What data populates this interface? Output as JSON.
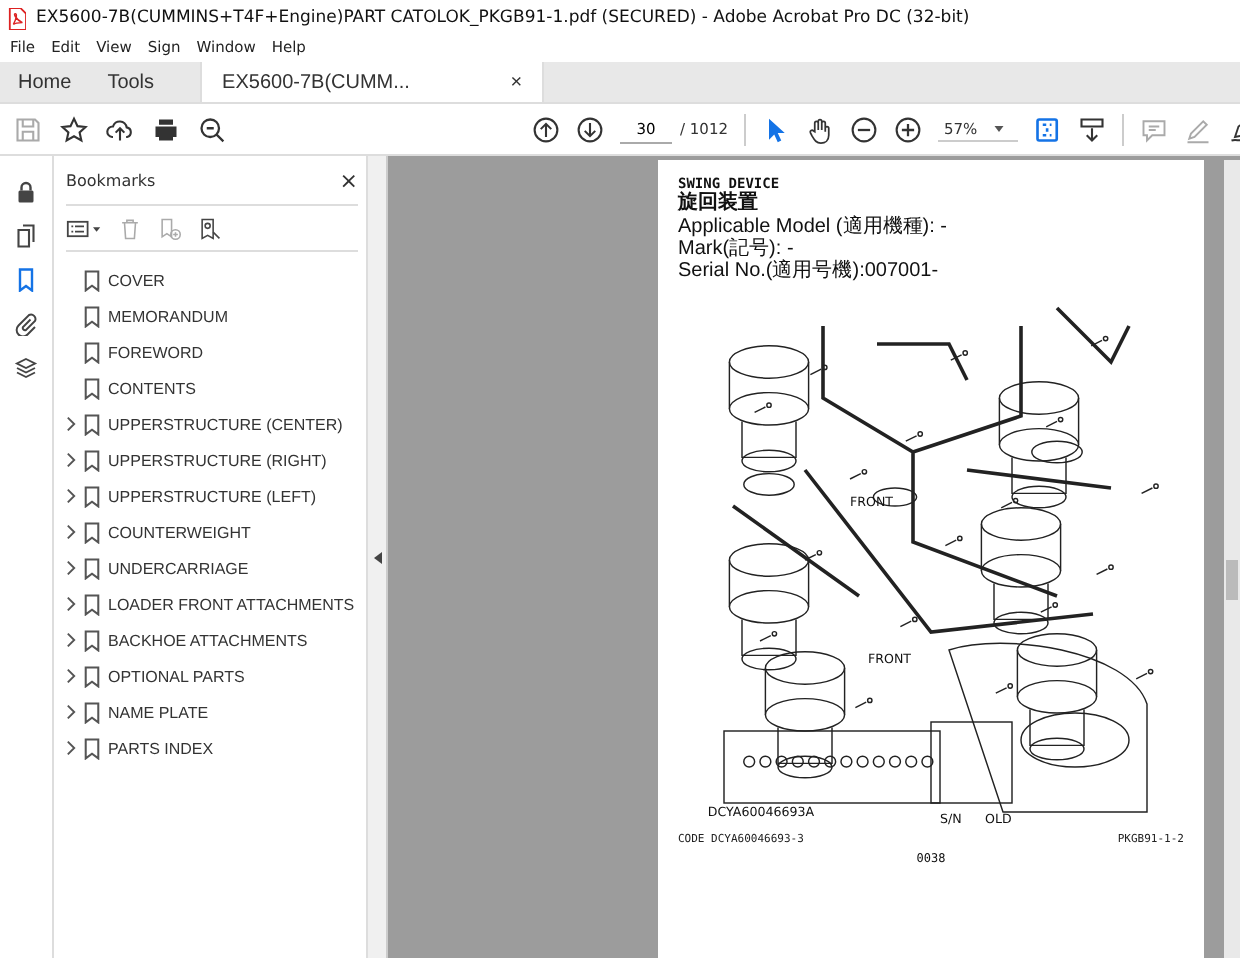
{
  "window": {
    "title": "EX5600-7B(CUMMINS+T4F+Engine)PART CATOLOK_PKGB91-1.pdf (SECURED) - Adobe Acrobat Pro DC (32-bit)"
  },
  "menu": [
    "File",
    "Edit",
    "View",
    "Sign",
    "Window",
    "Help"
  ],
  "tabs": [
    {
      "label": "Home",
      "selected": false
    },
    {
      "label": "Tools",
      "selected": false
    },
    {
      "label": "EX5600-7B(CUMM...",
      "selected": true,
      "close": "×"
    }
  ],
  "toolbar": {
    "page": "30",
    "page_total": "/ 1012",
    "zoom": "57%",
    "save_disabled": true,
    "select_tool_active": true,
    "hand_tool_active": false
  },
  "rail": [
    {
      "kind": "lock",
      "selected": false
    },
    {
      "kind": "pages",
      "selected": false
    },
    {
      "kind": "bookmark",
      "selected": true
    },
    {
      "kind": "clip",
      "selected": false
    },
    {
      "kind": "layers",
      "selected": false
    }
  ],
  "bookmarks": {
    "title": "Bookmarks",
    "close": "×",
    "items": [
      {
        "label": "COVER",
        "kind": "leaf"
      },
      {
        "label": "MEMORANDUM",
        "kind": "leaf"
      },
      {
        "label": "FOREWORD",
        "kind": "leaf"
      },
      {
        "label": "CONTENTS",
        "kind": "leaf"
      },
      {
        "label": "UPPERSTRUCTURE (CENTER)",
        "kind": "folder"
      },
      {
        "label": "UPPERSTRUCTURE (RIGHT)",
        "kind": "folder"
      },
      {
        "label": "UPPERSTRUCTURE (LEFT)",
        "kind": "folder"
      },
      {
        "label": "COUNTERWEIGHT",
        "kind": "folder"
      },
      {
        "label": "UNDERCARRIAGE",
        "kind": "folder"
      },
      {
        "label": "LOADER FRONT ATTACHMENTS",
        "kind": "folder"
      },
      {
        "label": "BACKHOE ATTACHMENTS",
        "kind": "folder"
      },
      {
        "label": "OPTIONAL PARTS",
        "kind": "folder"
      },
      {
        "label": "NAME PLATE",
        "kind": "folder"
      },
      {
        "label": "PARTS INDEX",
        "kind": "folder"
      }
    ]
  },
  "document": {
    "heading": "SWING DEVICE",
    "heading_ja": "旋回装置",
    "info": [
      "Applicable Model (適用機種): -",
      "Mark(記号): -",
      "Serial No.(適用号機):007001-"
    ],
    "diagram_labels": [
      "FRONT",
      "FRONT",
      "DCYA60046693A",
      "S/N",
      "OLD"
    ],
    "code": "CODE DCYA60046693-3",
    "ref": "PKGB91-1-2",
    "page_number": "0038"
  }
}
